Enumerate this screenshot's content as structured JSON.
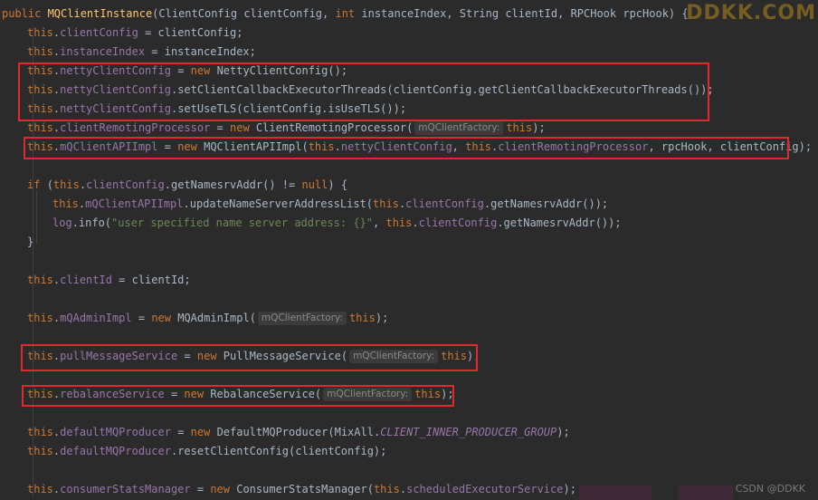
{
  "watermark": "DDKK.COM",
  "watermark_bottom": "CSDN @DDKK",
  "code": {
    "l0": {
      "t1": "public ",
      "t2": "MQClientInstance",
      "t3": "(ClientConfig clientConfig, ",
      "t4": "int ",
      "t5": "instanceIndex, String clientId, RPCHook rpcHook) {"
    },
    "l1": {
      "t1": "this",
      ".": ".",
      "t2": "clientConfig",
      "t3": " = clientConfig;"
    },
    "l2": {
      "t1": "this",
      "t2": "instanceIndex",
      "t3": " = instanceIndex;"
    },
    "l3": {
      "t1": "this",
      "t2": "nettyClientConfig",
      "t3": " = ",
      "t4": "new ",
      "t5": "NettyClientConfig();"
    },
    "l4": {
      "t1": "this",
      "t2": "nettyClientConfig",
      "t3": ".setClientCallbackExecutorThreads(clientConfig.getClientCallbackExecutorThreads());"
    },
    "l5": {
      "t1": "this",
      "t2": "nettyClientConfig",
      "t3": ".setUseTLS(clientConfig.isUseTLS());"
    },
    "l6": {
      "t1": "this",
      "t2": "clientRemotingProcessor",
      "t3": " = ",
      "t4": "new ",
      "t5": "ClientRemotingProcessor(",
      "hint": "mQClientFactory:",
      "t6": "this",
      "t7": ");"
    },
    "l7": {
      "t1": "this",
      "t2": "mQClientAPIImpl",
      "t3": " = ",
      "t4": "new ",
      "t5": "MQClientAPIImpl(",
      "t6": "this",
      "t7": "nettyClientConfig",
      "t8": ", ",
      "t9": "this",
      "t10": "clientRemotingProcessor",
      "t11": ", rpcHook, clientConfig);"
    },
    "l8": {
      "t1": "if ",
      "t2": "(",
      "t3": "this",
      "t4": "clientConfig",
      "t5": ".getNamesrvAddr() != ",
      "t6": "null",
      "t7": ") {"
    },
    "l9": {
      "t1": "this",
      "t2": "mQClientAPIImpl",
      "t3": ".updateNameServerAddressList(",
      "t4": "this",
      "t5": "clientConfig",
      "t6": ".getNamesrvAddr());"
    },
    "l10": {
      "t1": "log",
      "t2": ".info(",
      "t3": "\"user specified name server address: {}\"",
      "t4": ", ",
      "t5": "this",
      "t6": "clientConfig",
      "t7": ".getNamesrvAddr());"
    },
    "l11": {
      "t1": "}"
    },
    "l12": {
      "t1": "this",
      "t2": "clientId",
      "t3": " = clientId;"
    },
    "l13": {
      "t1": "this",
      "t2": "mQAdminImpl",
      "t3": " = ",
      "t4": "new ",
      "t5": "MQAdminImpl(",
      "hint": "mQClientFactory:",
      "t6": "this",
      "t7": ");"
    },
    "l14": {
      "t1": "this",
      "t2": "pullMessageService",
      "t3": " = ",
      "t4": "new ",
      "t5": "PullMessageService(",
      "hint": "mQClientFactory:",
      "t6": "this",
      "t7": ");"
    },
    "l15": {
      "t1": "this",
      "t2": "rebalanceService",
      "t3": " = ",
      "t4": "new ",
      "t5": "RebalanceService(",
      "hint": "mQClientFactory:",
      "t6": "this",
      "t7": ");"
    },
    "l16": {
      "t1": "this",
      "t2": "defaultMQProducer",
      "t3": " = ",
      "t4": "new ",
      "t5": "DefaultMQProducer(MixAll.",
      "t6": "CLIENT_INNER_PRODUCER_GROUP",
      "t7": ");"
    },
    "l17": {
      "t1": "this",
      "t2": "defaultMQProducer",
      "t3": ".resetClientConfig(clientConfig);"
    },
    "l18": {
      "t1": "this",
      "t2": "consumerStatsManager",
      "t3": " = ",
      "t4": "new ",
      "t5": "ConsumerStatsManager(",
      "t6": "this",
      "t7": "scheduledExecutorService",
      "t8": ");"
    }
  }
}
